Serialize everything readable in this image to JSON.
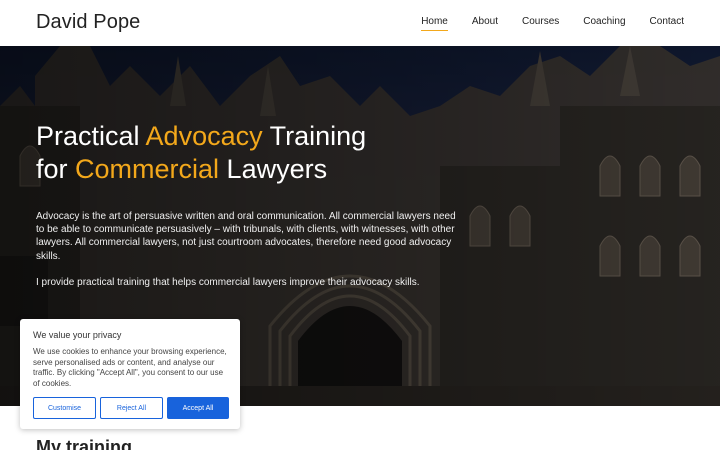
{
  "header": {
    "brand": "David Pope",
    "nav": [
      {
        "label": "Home",
        "active": true
      },
      {
        "label": "About",
        "active": false
      },
      {
        "label": "Courses",
        "active": false
      },
      {
        "label": "Coaching",
        "active": false
      },
      {
        "label": "Contact",
        "active": false
      }
    ]
  },
  "hero": {
    "headline": {
      "w1": "Practical ",
      "h1": "Advocacy",
      "w2": " Training",
      "w3": "for ",
      "h2": "Commercial",
      "w4": " Lawyers"
    },
    "paragraph1": "Advocacy is the art of persuasive written and oral communication. All commercial lawyers need to be able to communicate persuasively – with tribunals, with clients, with witnesses, with other lawyers. All commercial lawyers, not just courtroom advocates, therefore need good advocacy skills.",
    "paragraph2": "I provide practical training that helps commercial lawyers improve their advocacy skills.",
    "accent_color": "#f3a81b"
  },
  "section": {
    "title": "My training"
  },
  "cookie_banner": {
    "title": "We value your privacy",
    "text": "We use cookies to enhance your browsing experience, serve personalised ads or content, and analyse our traffic. By clicking \"Accept All\", you consent to our use of cookies.",
    "buttons": {
      "customise": "Customise",
      "reject": "Reject All",
      "accept": "Accept All"
    },
    "button_color": "#1863dc"
  }
}
